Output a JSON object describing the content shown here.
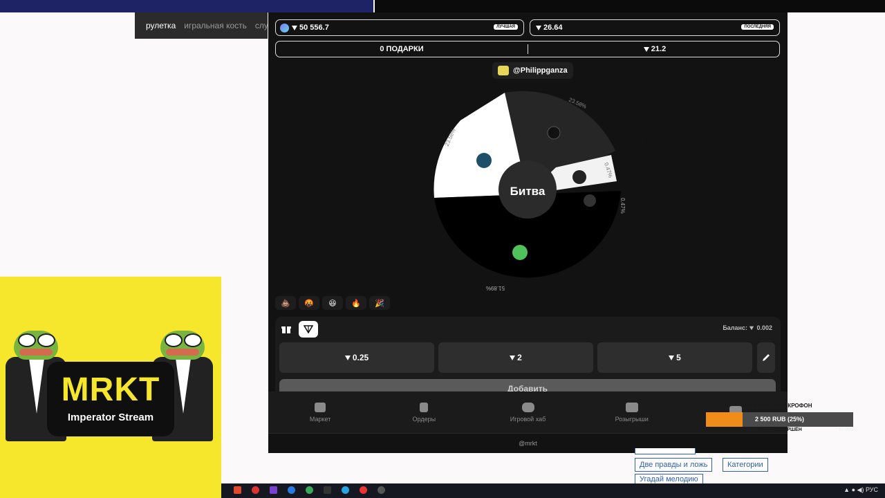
{
  "site_tabs": [
    "рулетка",
    "игральная кость",
    "случа"
  ],
  "stats": {
    "best_value": "50 556.7",
    "best_tag": "ЛУЧШАЯ",
    "last_value": "26.64",
    "last_tag": "ПОСЛЕДНЯЯ",
    "gifts_label": "0 ПОДАРКИ",
    "pool_value": "21.2"
  },
  "player": {
    "handle": "@Philippganza"
  },
  "wheel": {
    "center_label": "Битва",
    "segments": [
      {
        "label": "23.58%",
        "share": 23.58
      },
      {
        "label": "23.58%",
        "share": 23.58
      },
      {
        "label": "0.47%",
        "share": 0.47
      },
      {
        "label": "0.47%",
        "share": 0.47
      },
      {
        "label": "51.89%",
        "share": 51.89
      }
    ]
  },
  "reactions": [
    "💩",
    "🤬",
    "😆",
    "🔥",
    "🎉"
  ],
  "bet": {
    "balance_label": "Баланс:",
    "balance_value": "0.002",
    "amounts": [
      "0.25",
      "2",
      "5"
    ],
    "add_label": "Добавить"
  },
  "nav": [
    {
      "label": "Маркет",
      "icon": "gift-icon"
    },
    {
      "label": "Ордеры",
      "icon": "clipboard-icon"
    },
    {
      "label": "Игровой хаб",
      "icon": "gamepad-icon"
    },
    {
      "label": "Розыгрыши",
      "icon": "ticket-icon"
    },
    {
      "label": "",
      "icon": "archive-icon"
    }
  ],
  "footer": "@mrkt",
  "promo": {
    "brand": "MRKT",
    "subtitle": "Imperator Stream"
  },
  "donation_goal": {
    "title": "НА ВЕБКУ И МИКРОФОН",
    "progress_text": "2 500 RUB (25%)",
    "progress": 0.25,
    "min": "0",
    "caption": "СБОР ЗАВЕРШЁН",
    "max": "10 000"
  },
  "links": [
    "Две правды и ложь",
    "Категории",
    "Угадай мелодию"
  ],
  "taskbar": {
    "lang": "РУС"
  },
  "colors": {
    "accent": "#f08c1a",
    "promo_bg": "#f7e72c",
    "app_bg": "#121212"
  }
}
